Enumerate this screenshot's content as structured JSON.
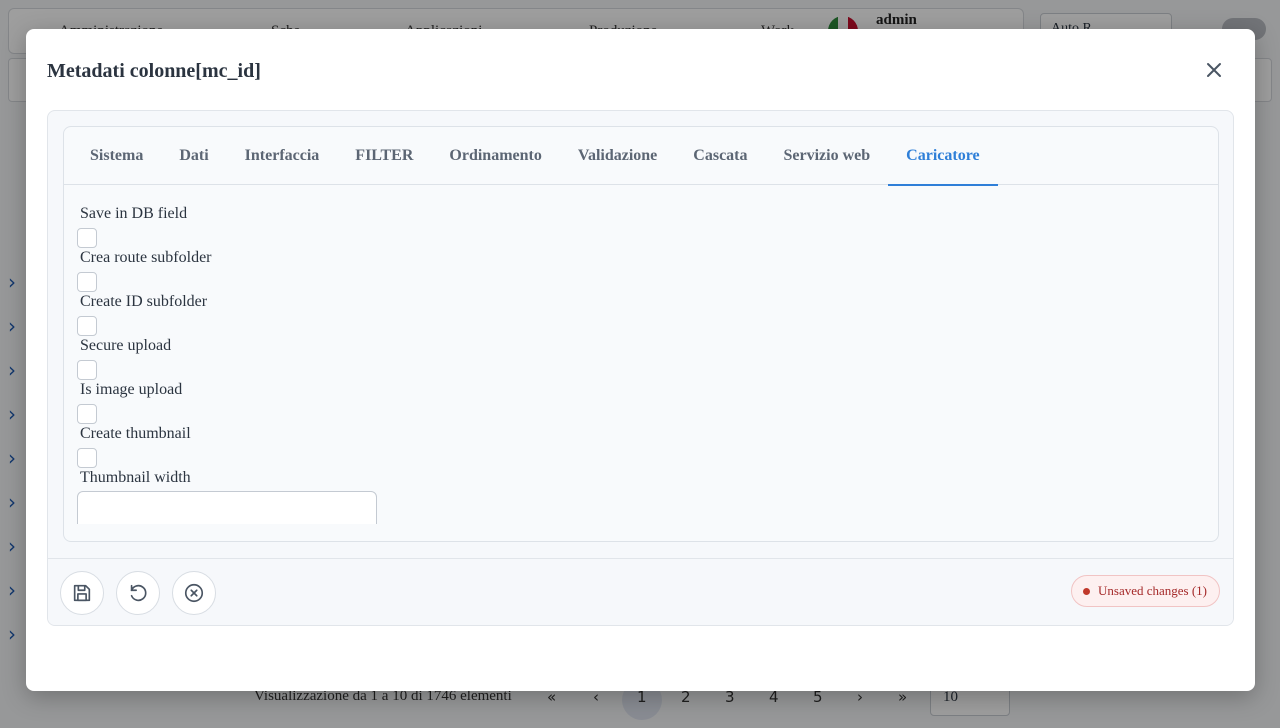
{
  "background": {
    "topbar_items": [
      "Amministrazione",
      "Sche",
      "Applicazioni",
      "Produzione",
      "Work"
    ],
    "user_name": "admin",
    "select_value": "Auto R",
    "pager_text": "Visualizzazione da 1 a 10 di 1746 elementi",
    "pages": [
      "1",
      "2",
      "3",
      "4",
      "5"
    ],
    "per_page": "10"
  },
  "modal": {
    "title": "Metadati colonne[mc_id]",
    "tabs": [
      {
        "label": "Sistema",
        "active": false
      },
      {
        "label": "Dati",
        "active": false
      },
      {
        "label": "Interfaccia",
        "active": false
      },
      {
        "label": "FILTER",
        "active": false
      },
      {
        "label": "Ordinamento",
        "active": false
      },
      {
        "label": "Validazione",
        "active": false
      },
      {
        "label": "Cascata",
        "active": false
      },
      {
        "label": "Servizio web",
        "active": false
      },
      {
        "label": "Caricatore",
        "active": true
      }
    ],
    "fields": {
      "save_in_db": {
        "label": "Save in DB field",
        "checked": false
      },
      "route_subfolder": {
        "label": "Crea route subfolder",
        "checked": false
      },
      "id_subfolder": {
        "label": "Create ID subfolder",
        "checked": false
      },
      "secure_upload": {
        "label": "Secure upload",
        "checked": false
      },
      "image_upload": {
        "label": "Is image upload",
        "checked": false
      },
      "create_thumbnail": {
        "label": "Create thumbnail",
        "checked": false
      },
      "thumbnail_width": {
        "label": "Thumbnail width",
        "value": ""
      }
    },
    "footer": {
      "unsaved_text": "Unsaved changes (1)"
    }
  },
  "colors": {
    "accent": "#2f7fd8",
    "unsaved_text": "#a52a2a",
    "unsaved_bg": "#fdf0f0"
  }
}
